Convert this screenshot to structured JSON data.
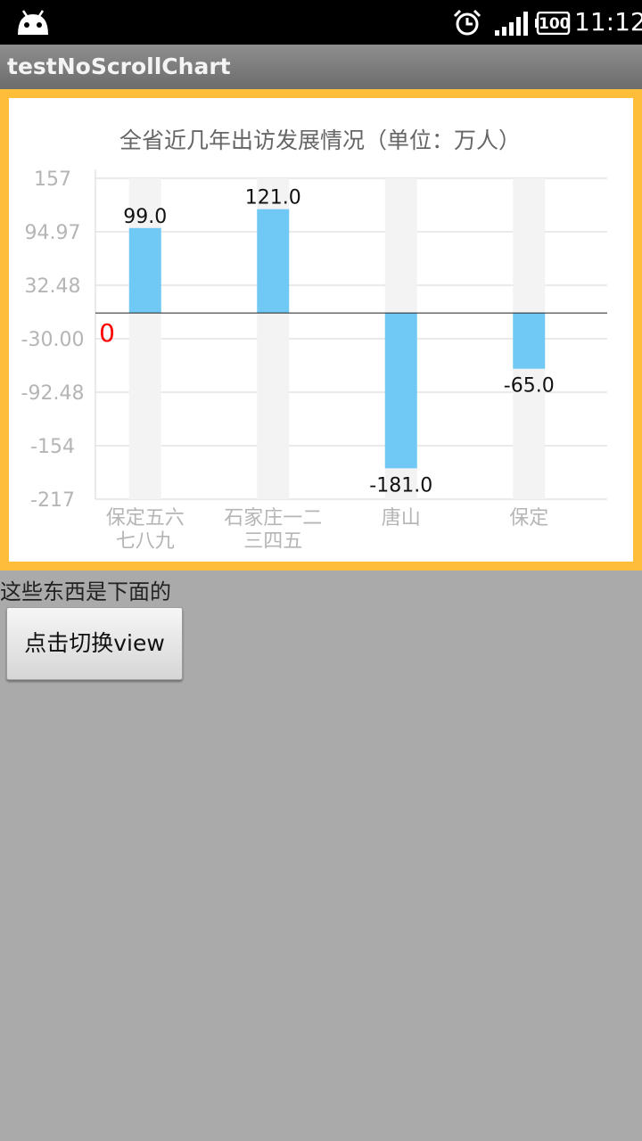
{
  "status_bar": {
    "time": "11:12",
    "battery": "100",
    "icons": [
      "android-icon",
      "alarm-clock-icon",
      "signal-strength-icon",
      "battery-icon"
    ]
  },
  "title_bar": {
    "title": "testNoScrollChart"
  },
  "chart_data": {
    "type": "bar",
    "title": "全省近几年出访发展情况（单位：万人）",
    "categories": [
      "保定五六\n七八九",
      "石家庄一二\n三四五",
      "唐山",
      "保定"
    ],
    "values": [
      99.0,
      121.0,
      -181.0,
      -65.0
    ],
    "value_labels": [
      "99.0",
      "121.0",
      "-181.0",
      "-65.0"
    ],
    "y_ticks": [
      "157",
      "94.97",
      "32.48",
      "-30.00",
      "-92.48",
      "-154",
      "-217"
    ],
    "ylim": [
      -217,
      157
    ],
    "zero_label": "0",
    "grid": true,
    "colors": {
      "bar": "#70c9f4",
      "bar_background": "#f3f3f3",
      "zero_label": "#ff0000",
      "axis_text": "#b5b5b5",
      "title": "#666666",
      "grid": "#d4d4d4"
    }
  },
  "below_text": "这些东西是下面的",
  "button": {
    "label": "点击切换view"
  }
}
